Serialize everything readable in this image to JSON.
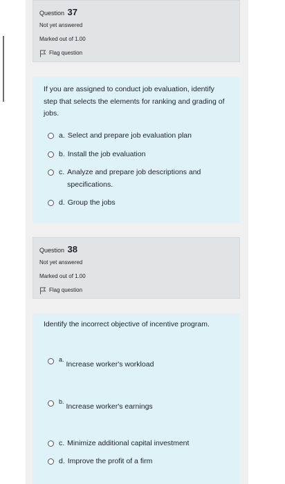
{
  "questions": [
    {
      "label": "Question",
      "number": "37",
      "status": "Not yet answered",
      "marks": "Marked out of 1.00",
      "flag_label": "Flag question",
      "text": "If you are assigned to conduct job evaluation, identify step that selects the elements for ranking and grading of jobs.",
      "options": [
        {
          "letter": "a.",
          "text": "Select and prepare job evaluation plan"
        },
        {
          "letter": "b.",
          "text": "Install the job evaluation"
        },
        {
          "letter": "c.",
          "text": "Analyze and prepare job descriptions and specifications."
        },
        {
          "letter": "d.",
          "text": "Group the jobs"
        }
      ]
    },
    {
      "label": "Question",
      "number": "38",
      "status": "Not yet answered",
      "marks": "Marked out of 1.00",
      "flag_label": "Flag question",
      "text": "Identify the incorrect objective of incentive program.",
      "options": [
        {
          "letter": "a.",
          "text": "Increase worker's workload"
        },
        {
          "letter": "b.",
          "text": "Increase worker's earnings"
        },
        {
          "letter": "c.",
          "text": "Minimize additional capital investment"
        },
        {
          "letter": "d.",
          "text": "Improve the profit of a firm"
        }
      ]
    }
  ],
  "colors": {
    "info_bg": "#e1e4e6",
    "content_bg": "#def2f8",
    "frame_bg": "#f0f0f0"
  }
}
